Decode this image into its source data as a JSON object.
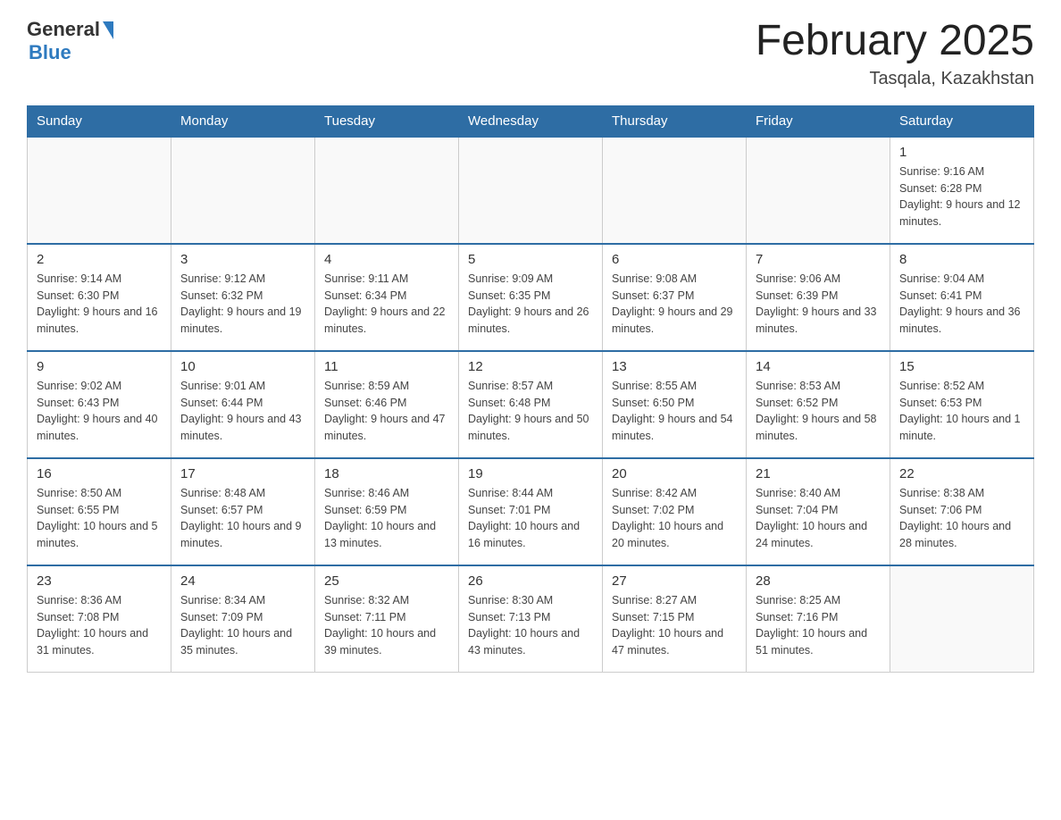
{
  "header": {
    "logo_general": "General",
    "logo_blue": "Blue",
    "month_title": "February 2025",
    "location": "Tasqala, Kazakhstan"
  },
  "weekdays": [
    "Sunday",
    "Monday",
    "Tuesday",
    "Wednesday",
    "Thursday",
    "Friday",
    "Saturday"
  ],
  "weeks": [
    [
      {
        "day": "",
        "sunrise": "",
        "sunset": "",
        "daylight": ""
      },
      {
        "day": "",
        "sunrise": "",
        "sunset": "",
        "daylight": ""
      },
      {
        "day": "",
        "sunrise": "",
        "sunset": "",
        "daylight": ""
      },
      {
        "day": "",
        "sunrise": "",
        "sunset": "",
        "daylight": ""
      },
      {
        "day": "",
        "sunrise": "",
        "sunset": "",
        "daylight": ""
      },
      {
        "day": "",
        "sunrise": "",
        "sunset": "",
        "daylight": ""
      },
      {
        "day": "1",
        "sunrise": "Sunrise: 9:16 AM",
        "sunset": "Sunset: 6:28 PM",
        "daylight": "Daylight: 9 hours and 12 minutes."
      }
    ],
    [
      {
        "day": "2",
        "sunrise": "Sunrise: 9:14 AM",
        "sunset": "Sunset: 6:30 PM",
        "daylight": "Daylight: 9 hours and 16 minutes."
      },
      {
        "day": "3",
        "sunrise": "Sunrise: 9:12 AM",
        "sunset": "Sunset: 6:32 PM",
        "daylight": "Daylight: 9 hours and 19 minutes."
      },
      {
        "day": "4",
        "sunrise": "Sunrise: 9:11 AM",
        "sunset": "Sunset: 6:34 PM",
        "daylight": "Daylight: 9 hours and 22 minutes."
      },
      {
        "day": "5",
        "sunrise": "Sunrise: 9:09 AM",
        "sunset": "Sunset: 6:35 PM",
        "daylight": "Daylight: 9 hours and 26 minutes."
      },
      {
        "day": "6",
        "sunrise": "Sunrise: 9:08 AM",
        "sunset": "Sunset: 6:37 PM",
        "daylight": "Daylight: 9 hours and 29 minutes."
      },
      {
        "day": "7",
        "sunrise": "Sunrise: 9:06 AM",
        "sunset": "Sunset: 6:39 PM",
        "daylight": "Daylight: 9 hours and 33 minutes."
      },
      {
        "day": "8",
        "sunrise": "Sunrise: 9:04 AM",
        "sunset": "Sunset: 6:41 PM",
        "daylight": "Daylight: 9 hours and 36 minutes."
      }
    ],
    [
      {
        "day": "9",
        "sunrise": "Sunrise: 9:02 AM",
        "sunset": "Sunset: 6:43 PM",
        "daylight": "Daylight: 9 hours and 40 minutes."
      },
      {
        "day": "10",
        "sunrise": "Sunrise: 9:01 AM",
        "sunset": "Sunset: 6:44 PM",
        "daylight": "Daylight: 9 hours and 43 minutes."
      },
      {
        "day": "11",
        "sunrise": "Sunrise: 8:59 AM",
        "sunset": "Sunset: 6:46 PM",
        "daylight": "Daylight: 9 hours and 47 minutes."
      },
      {
        "day": "12",
        "sunrise": "Sunrise: 8:57 AM",
        "sunset": "Sunset: 6:48 PM",
        "daylight": "Daylight: 9 hours and 50 minutes."
      },
      {
        "day": "13",
        "sunrise": "Sunrise: 8:55 AM",
        "sunset": "Sunset: 6:50 PM",
        "daylight": "Daylight: 9 hours and 54 minutes."
      },
      {
        "day": "14",
        "sunrise": "Sunrise: 8:53 AM",
        "sunset": "Sunset: 6:52 PM",
        "daylight": "Daylight: 9 hours and 58 minutes."
      },
      {
        "day": "15",
        "sunrise": "Sunrise: 8:52 AM",
        "sunset": "Sunset: 6:53 PM",
        "daylight": "Daylight: 10 hours and 1 minute."
      }
    ],
    [
      {
        "day": "16",
        "sunrise": "Sunrise: 8:50 AM",
        "sunset": "Sunset: 6:55 PM",
        "daylight": "Daylight: 10 hours and 5 minutes."
      },
      {
        "day": "17",
        "sunrise": "Sunrise: 8:48 AM",
        "sunset": "Sunset: 6:57 PM",
        "daylight": "Daylight: 10 hours and 9 minutes."
      },
      {
        "day": "18",
        "sunrise": "Sunrise: 8:46 AM",
        "sunset": "Sunset: 6:59 PM",
        "daylight": "Daylight: 10 hours and 13 minutes."
      },
      {
        "day": "19",
        "sunrise": "Sunrise: 8:44 AM",
        "sunset": "Sunset: 7:01 PM",
        "daylight": "Daylight: 10 hours and 16 minutes."
      },
      {
        "day": "20",
        "sunrise": "Sunrise: 8:42 AM",
        "sunset": "Sunset: 7:02 PM",
        "daylight": "Daylight: 10 hours and 20 minutes."
      },
      {
        "day": "21",
        "sunrise": "Sunrise: 8:40 AM",
        "sunset": "Sunset: 7:04 PM",
        "daylight": "Daylight: 10 hours and 24 minutes."
      },
      {
        "day": "22",
        "sunrise": "Sunrise: 8:38 AM",
        "sunset": "Sunset: 7:06 PM",
        "daylight": "Daylight: 10 hours and 28 minutes."
      }
    ],
    [
      {
        "day": "23",
        "sunrise": "Sunrise: 8:36 AM",
        "sunset": "Sunset: 7:08 PM",
        "daylight": "Daylight: 10 hours and 31 minutes."
      },
      {
        "day": "24",
        "sunrise": "Sunrise: 8:34 AM",
        "sunset": "Sunset: 7:09 PM",
        "daylight": "Daylight: 10 hours and 35 minutes."
      },
      {
        "day": "25",
        "sunrise": "Sunrise: 8:32 AM",
        "sunset": "Sunset: 7:11 PM",
        "daylight": "Daylight: 10 hours and 39 minutes."
      },
      {
        "day": "26",
        "sunrise": "Sunrise: 8:30 AM",
        "sunset": "Sunset: 7:13 PM",
        "daylight": "Daylight: 10 hours and 43 minutes."
      },
      {
        "day": "27",
        "sunrise": "Sunrise: 8:27 AM",
        "sunset": "Sunset: 7:15 PM",
        "daylight": "Daylight: 10 hours and 47 minutes."
      },
      {
        "day": "28",
        "sunrise": "Sunrise: 8:25 AM",
        "sunset": "Sunset: 7:16 PM",
        "daylight": "Daylight: 10 hours and 51 minutes."
      },
      {
        "day": "",
        "sunrise": "",
        "sunset": "",
        "daylight": ""
      }
    ]
  ]
}
